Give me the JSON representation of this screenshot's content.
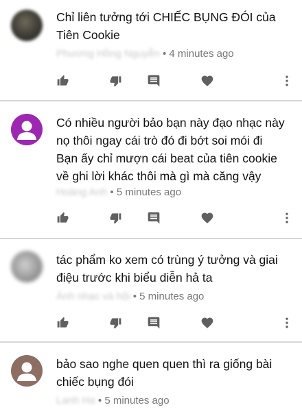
{
  "comments": [
    {
      "avatar": "blurred-photo",
      "text_lines": [
        "Chỉ liên tưởng tới CHIẾC BỤNG ĐÓI của",
        "Tiên Cookie"
      ],
      "author": "Phương Hồng Nguyễn",
      "time": "4 minutes ago"
    },
    {
      "avatar": "default-purple",
      "avatar_color": "#9c27b0",
      "text_lines": [
        "Có nhiều người bảo bạn này đạo nhạc này",
        "nọ thôi ngay cái trò đó đi bớt soi mói đi",
        "Bạn ấy chỉ mượn cái beat của tiên cookie",
        "về ghi lời khác thôi mà gì mà căng vậy"
      ],
      "author": "Hoàng Anh",
      "time": "5 minutes ago"
    },
    {
      "avatar": "blurred-photo",
      "text_lines": [
        "tác phẩm ko xem có trùng ý tưởng và giai",
        "điệu trước khi biểu diễn hả ta"
      ],
      "author": "Ánh nhạc và hội",
      "time": "5 minutes ago"
    },
    {
      "avatar": "default-brown",
      "avatar_color": "#8d6e63",
      "text_lines": [
        "bảo sao nghe quen quen thì ra giống bài",
        "chiếc bụng đói"
      ],
      "author": "Lanh Ha",
      "time": "5 minutes ago"
    }
  ],
  "icons": {
    "like": "thumb-up-icon",
    "dislike": "thumb-down-icon",
    "reply": "reply-icon",
    "heart": "heart-icon",
    "more": "more-vert-icon"
  },
  "colors": {
    "icon": "#606060",
    "meta": "#777777",
    "divider": "#d6d6d6"
  }
}
